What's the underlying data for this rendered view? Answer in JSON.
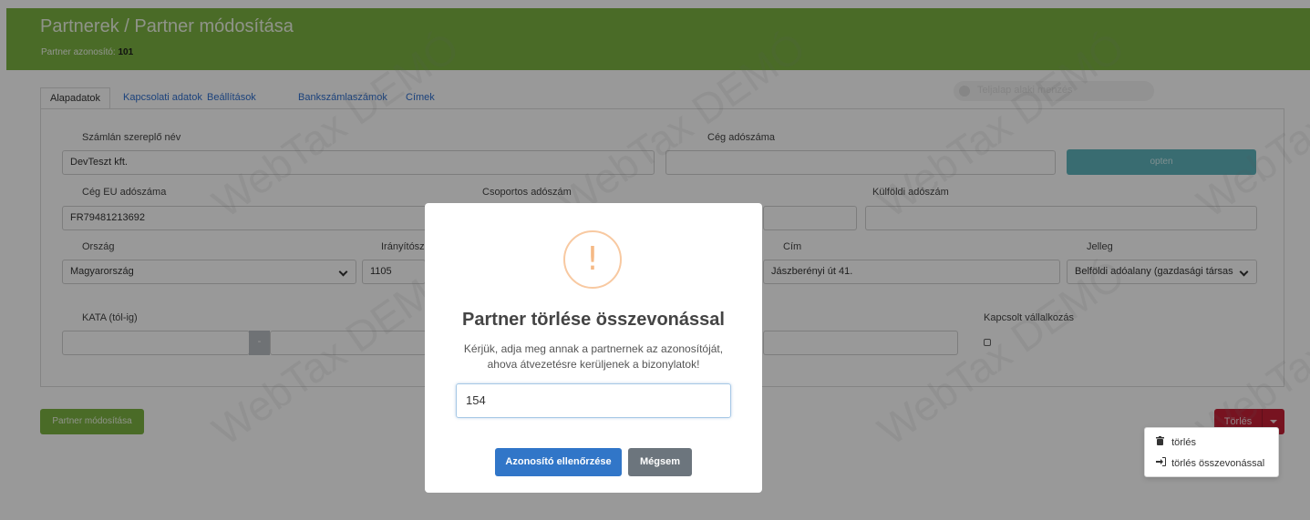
{
  "header": {
    "title": "Partnerek / Partner módosítása",
    "id_label": "Partner azonosító:",
    "id_value": "101"
  },
  "toggle_label": "Teljalap alaki menzés",
  "tabs": [
    "Alapadatok",
    "Kapcsolati adatok",
    "Beállítások",
    "Bankszámlaszámok",
    "Címek"
  ],
  "form": {
    "szamlan_nev_label": "Számlán szereplő név",
    "szamlan_nev_value": "DevTeszt kft.",
    "ceg_adoszam_label": "Cég adószáma",
    "ceg_adoszam_value": "",
    "open_button": "opten",
    "eu_adoszam_label": "Cég EU adószáma",
    "eu_adoszam_value": "FR79481213692",
    "csoportos_label": "Csoportos adószám",
    "kulfoldi_label": "Külföldi adószám",
    "orszag_label": "Ország",
    "orszag_value": "Magyarország",
    "iranyitoszam_label": "Irányítósz",
    "iranyitoszam_value": "1105",
    "cim_label": "Cím",
    "cim_value": "Jászberényi út 41.",
    "jelleg_label": "Jelleg",
    "jelleg_value": "Belföldi adóalany (gazdasági társas",
    "kata_label": "KATA (tól-ig)",
    "kata_separator": "-",
    "kapcsolt_label": "Kapcsolt vállalkozás"
  },
  "buttons": {
    "partner_modositasa": "Partner módosítása",
    "torles": "Törlés"
  },
  "dropdown": {
    "items": [
      "törlés",
      "törlés összevonással"
    ]
  },
  "watermark": "WebTax DEMÓ",
  "modal": {
    "title": "Partner törlése összevonással",
    "text_line1": "Kérjük, adja meg annak a partnernek az azonosítóját,",
    "text_line2": "ahova átvezetésre kerüljenek a bizonylatok!",
    "input_value": "154",
    "confirm_button": "Azonosító ellenőrzése",
    "cancel_button": "Mégsem"
  },
  "colors": {
    "header": "#7cb342",
    "danger": "#c62036",
    "primary": "#3176c8",
    "secondary": "#6c757d",
    "warning_icon": "#f5b985"
  }
}
